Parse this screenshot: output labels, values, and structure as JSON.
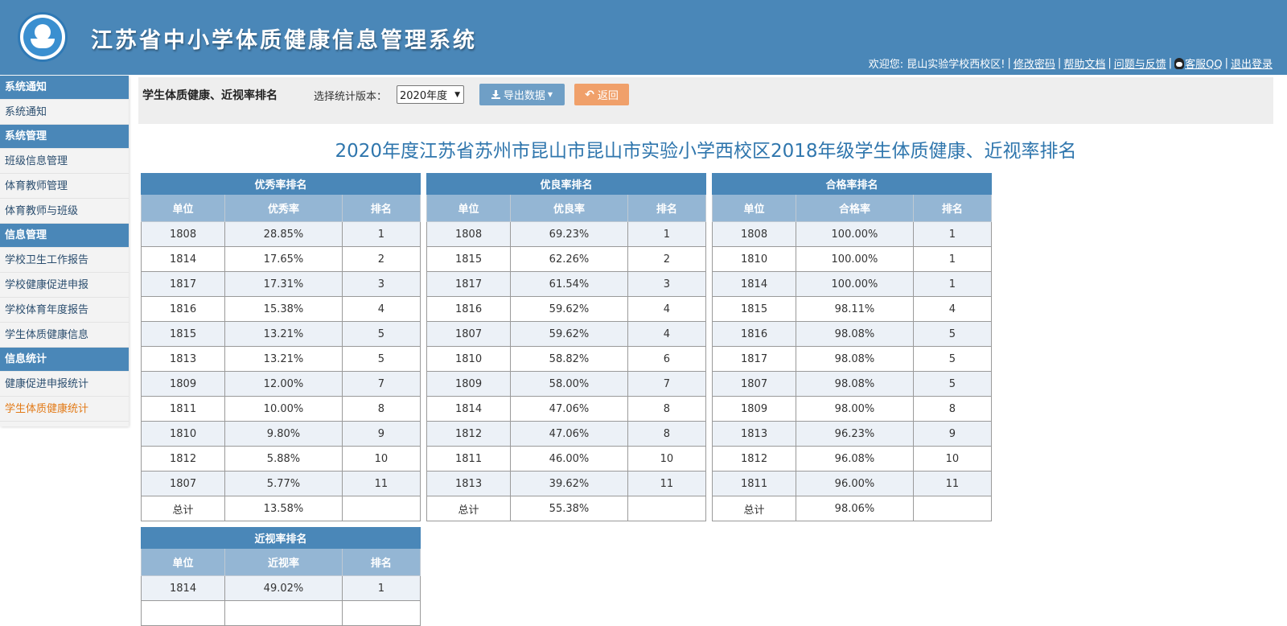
{
  "header": {
    "title": "江苏省中小学体质健康信息管理系统",
    "welcome": "欢迎您: 昆山实验学校西校区!",
    "links": [
      "修改密码",
      "帮助文档",
      "问题与反馈",
      "客服QQ",
      "退出登录"
    ]
  },
  "sidebar": {
    "groups": [
      {
        "title": "系统通知",
        "items": [
          {
            "label": "系统通知"
          }
        ]
      },
      {
        "title": "系统管理",
        "items": [
          {
            "label": "班级信息管理"
          },
          {
            "label": "体育教师管理"
          },
          {
            "label": "体育教师与班级"
          }
        ]
      },
      {
        "title": "信息管理",
        "items": [
          {
            "label": "学校卫生工作报告"
          },
          {
            "label": "学校健康促进申报"
          },
          {
            "label": "学校体育年度报告"
          },
          {
            "label": "学生体质健康信息"
          }
        ]
      },
      {
        "title": "信息统计",
        "items": [
          {
            "label": "健康促进申报统计"
          },
          {
            "label": "学生体质健康统计",
            "active": true
          }
        ]
      }
    ]
  },
  "toolbar": {
    "title": "学生体质健康、近视率排名",
    "version_label": "选择统计版本：",
    "version_value": "2020年度",
    "export_label": "导出数据",
    "back_label": "返回"
  },
  "report_title": "2020年度江苏省苏州市昆山市昆山市实验小学西校区2018年级学生体质健康、近视率排名",
  "tables": {
    "excellent": {
      "caption": "优秀率排名",
      "headers": [
        "单位",
        "优秀率",
        "排名"
      ],
      "rows": [
        [
          "1808",
          "28.85%",
          "1"
        ],
        [
          "1814",
          "17.65%",
          "2"
        ],
        [
          "1817",
          "17.31%",
          "3"
        ],
        [
          "1816",
          "15.38%",
          "4"
        ],
        [
          "1815",
          "13.21%",
          "5"
        ],
        [
          "1813",
          "13.21%",
          "5"
        ],
        [
          "1809",
          "12.00%",
          "7"
        ],
        [
          "1811",
          "10.00%",
          "8"
        ],
        [
          "1810",
          "9.80%",
          "9"
        ],
        [
          "1812",
          "5.88%",
          "10"
        ],
        [
          "1807",
          "5.77%",
          "11"
        ]
      ],
      "total": [
        "总计",
        "13.58%",
        ""
      ]
    },
    "good": {
      "caption": "优良率排名",
      "headers": [
        "单位",
        "优良率",
        "排名"
      ],
      "rows": [
        [
          "1808",
          "69.23%",
          "1"
        ],
        [
          "1815",
          "62.26%",
          "2"
        ],
        [
          "1817",
          "61.54%",
          "3"
        ],
        [
          "1816",
          "59.62%",
          "4"
        ],
        [
          "1807",
          "59.62%",
          "4"
        ],
        [
          "1810",
          "58.82%",
          "6"
        ],
        [
          "1809",
          "58.00%",
          "7"
        ],
        [
          "1814",
          "47.06%",
          "8"
        ],
        [
          "1812",
          "47.06%",
          "8"
        ],
        [
          "1811",
          "46.00%",
          "10"
        ],
        [
          "1813",
          "39.62%",
          "11"
        ]
      ],
      "total": [
        "总计",
        "55.38%",
        ""
      ]
    },
    "pass": {
      "caption": "合格率排名",
      "headers": [
        "单位",
        "合格率",
        "排名"
      ],
      "rows": [
        [
          "1808",
          "100.00%",
          "1"
        ],
        [
          "1810",
          "100.00%",
          "1"
        ],
        [
          "1814",
          "100.00%",
          "1"
        ],
        [
          "1815",
          "98.11%",
          "4"
        ],
        [
          "1816",
          "98.08%",
          "5"
        ],
        [
          "1817",
          "98.08%",
          "5"
        ],
        [
          "1807",
          "98.08%",
          "5"
        ],
        [
          "1809",
          "98.00%",
          "8"
        ],
        [
          "1813",
          "96.23%",
          "9"
        ],
        [
          "1812",
          "96.08%",
          "10"
        ],
        [
          "1811",
          "96.00%",
          "11"
        ]
      ],
      "total": [
        "总计",
        "98.06%",
        ""
      ]
    },
    "myopia": {
      "caption": "近视率排名",
      "headers": [
        "单位",
        "近视率",
        "排名"
      ],
      "rows": [
        [
          "1814",
          "49.02%",
          "1"
        ]
      ]
    }
  }
}
